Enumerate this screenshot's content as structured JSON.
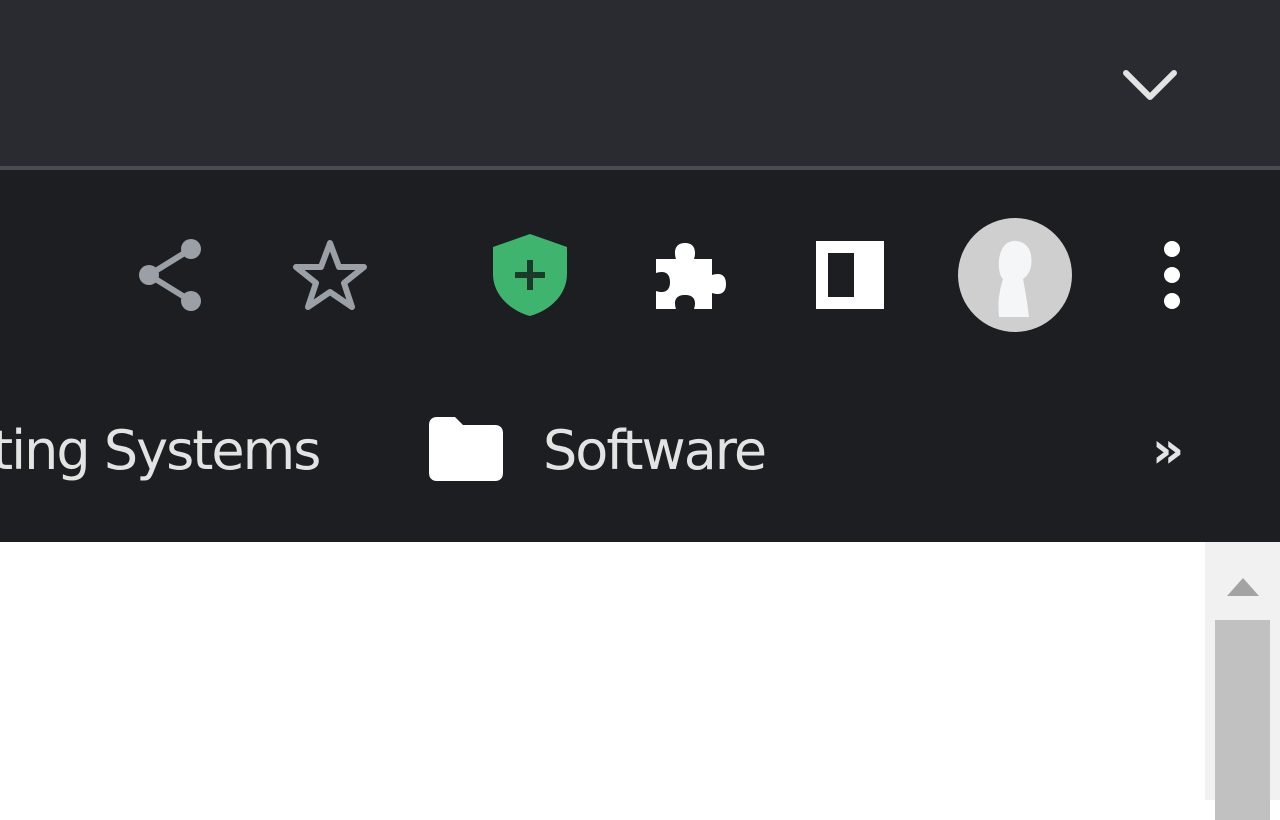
{
  "tabstrip": {
    "tab_search_icon": "chevron-down-icon"
  },
  "toolbar": {
    "icons": [
      "share-icon",
      "star-icon",
      "shield-plus-icon",
      "puzzle-icon",
      "side-panel-icon",
      "avatar",
      "more-vert-icon"
    ]
  },
  "bookmarks": {
    "items": [
      {
        "label": "ting Systems"
      },
      {
        "label": "Software",
        "icon": "folder-icon"
      }
    ],
    "overflow_label": "»"
  },
  "colors": {
    "tabstrip_bg": "#292b30",
    "toolbar_bg": "#1c1e22",
    "shield_green": "#3fb46f",
    "text": "#e3e3e3"
  }
}
